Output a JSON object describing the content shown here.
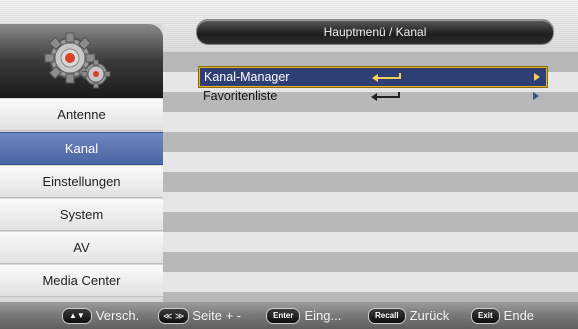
{
  "header": {
    "title": "Hauptmenü / Kanal"
  },
  "sidebar": {
    "items": [
      {
        "label": "Antenne",
        "active": false
      },
      {
        "label": "Kanal",
        "active": true
      },
      {
        "label": "Einstellungen",
        "active": false
      },
      {
        "label": "System",
        "active": false
      },
      {
        "label": "AV",
        "active": false
      },
      {
        "label": "Media Center",
        "active": false
      }
    ]
  },
  "content": {
    "entries": [
      {
        "label": "Kanal-Manager",
        "selected": true
      },
      {
        "label": "Favoritenliste",
        "selected": false
      }
    ]
  },
  "footer": {
    "hints": [
      {
        "key": "▲▼",
        "label": "Versch."
      },
      {
        "key": "≪ ≫",
        "label": "Seite + -"
      },
      {
        "key": "Enter",
        "label": "Eing..."
      },
      {
        "key": "Recall",
        "label": "Zurück"
      },
      {
        "key": "Exit",
        "label": "Ende"
      }
    ]
  },
  "colors": {
    "accent": "#4a64a5",
    "selection": "#2f3f76",
    "selection_border": "#e6b22a"
  }
}
